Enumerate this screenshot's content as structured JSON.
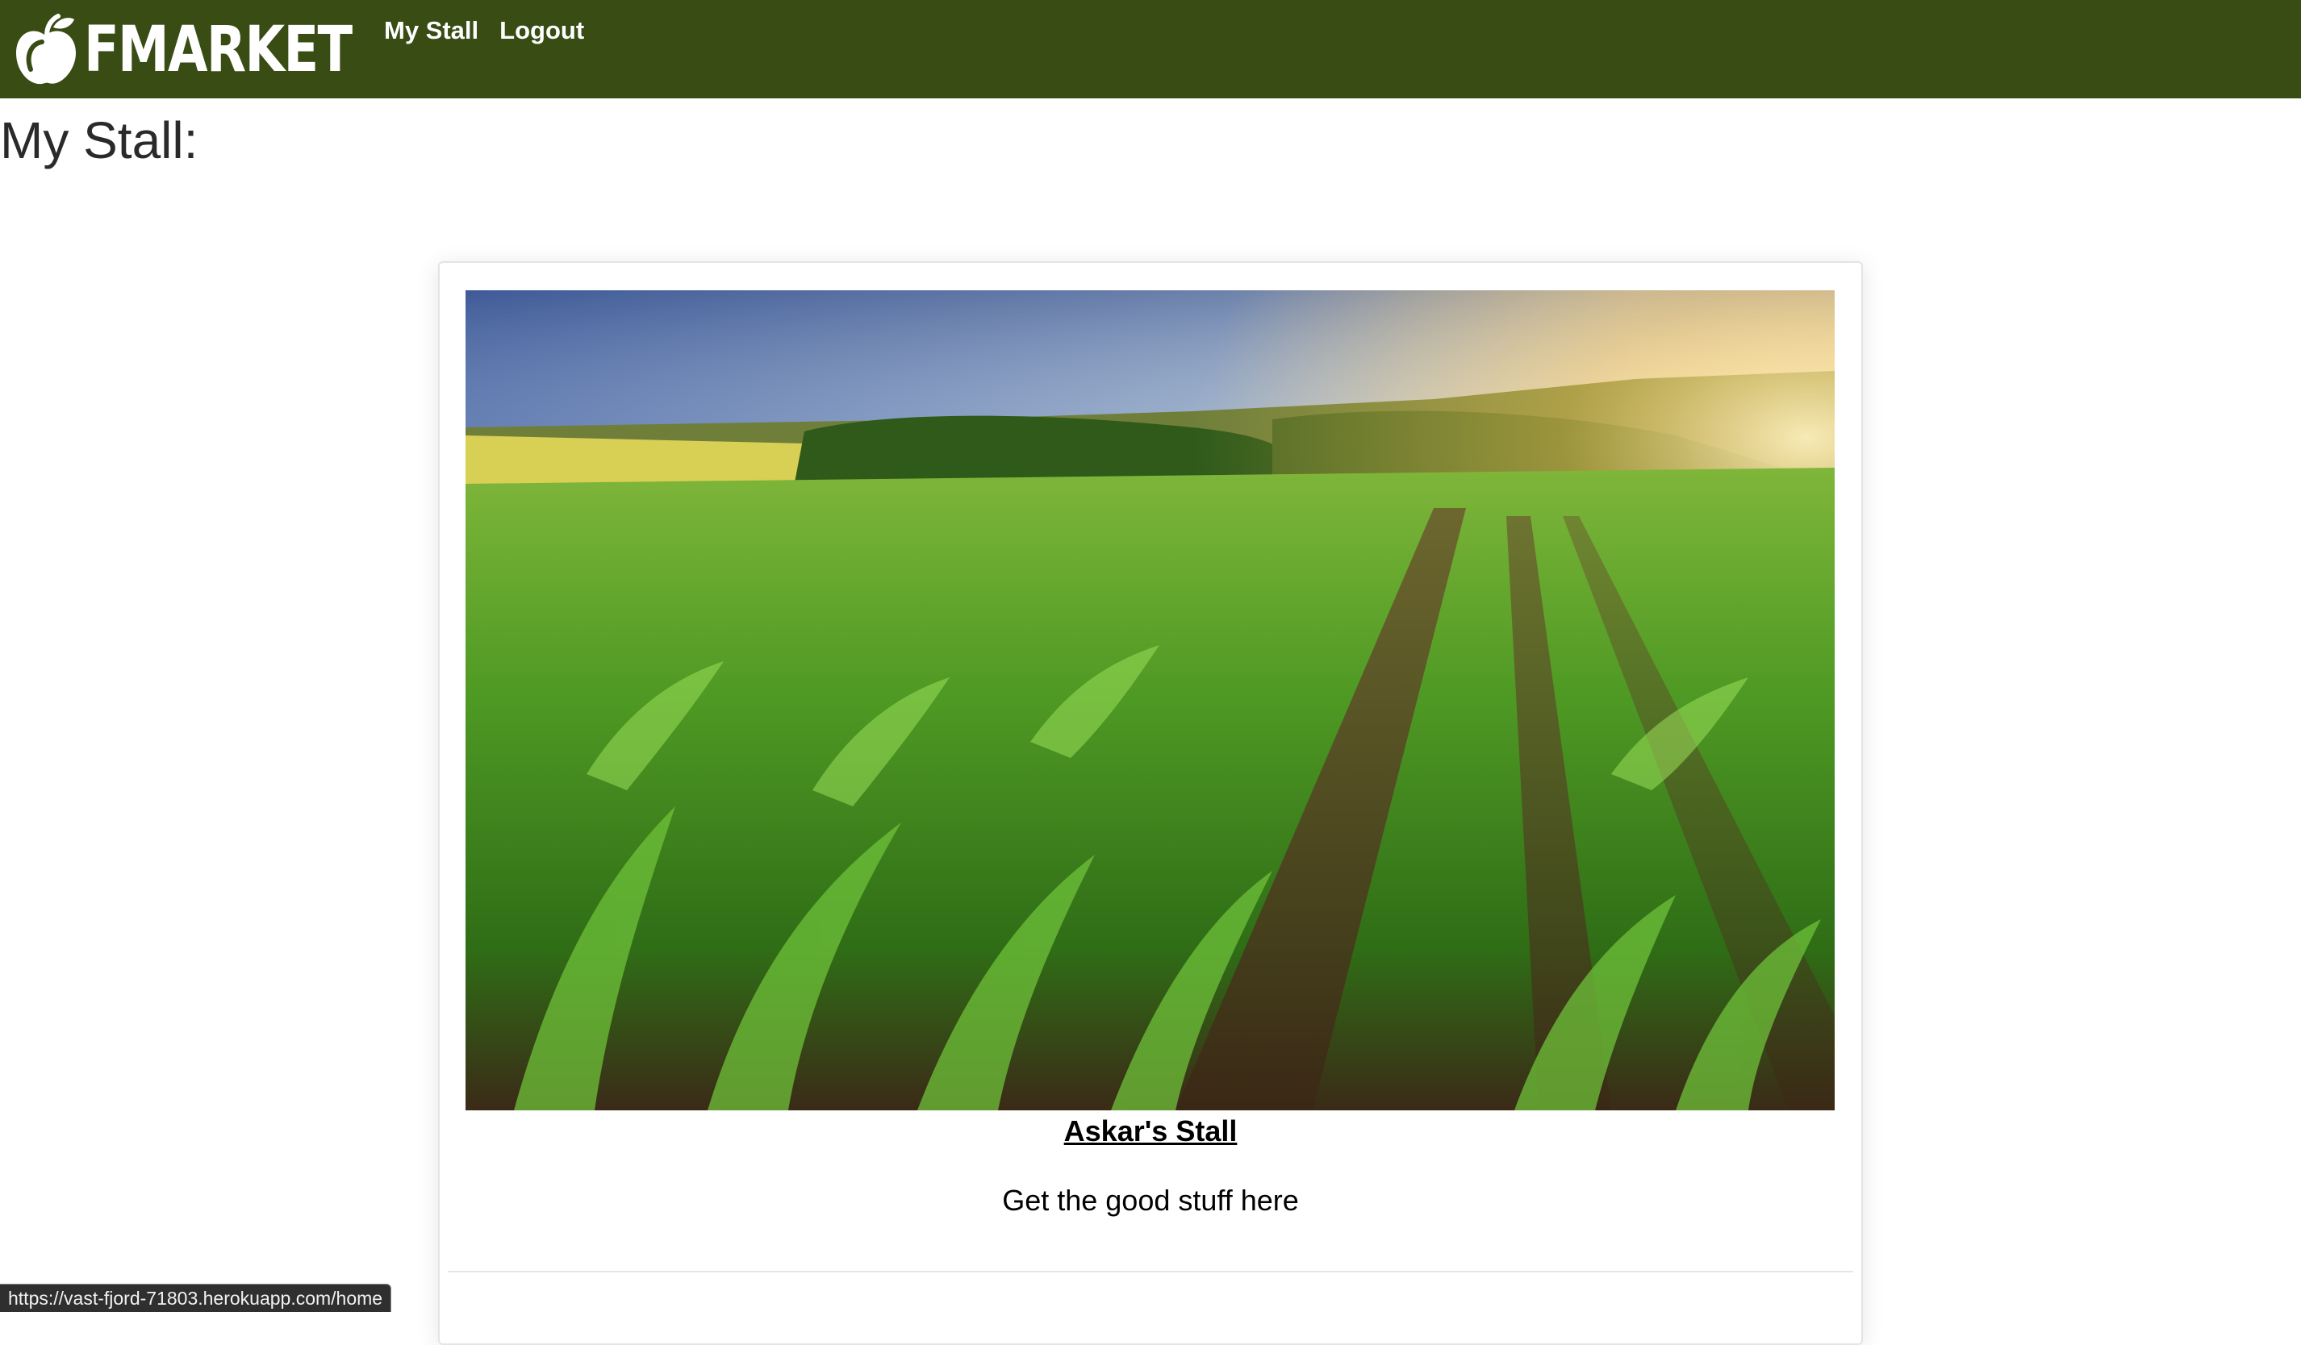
{
  "navbar": {
    "brand": "FMARKET",
    "links": [
      {
        "label": "My Stall"
      },
      {
        "label": "Logout"
      }
    ],
    "background_color": "#384c14"
  },
  "page": {
    "title": "My Stall:"
  },
  "stall_card": {
    "name": "Askar's Stall",
    "description": "Get the good stuff here",
    "image_icon": "corn-field-photo"
  },
  "status_bar": {
    "url": "https://vast-fjord-71803.herokuapp.com/home"
  }
}
